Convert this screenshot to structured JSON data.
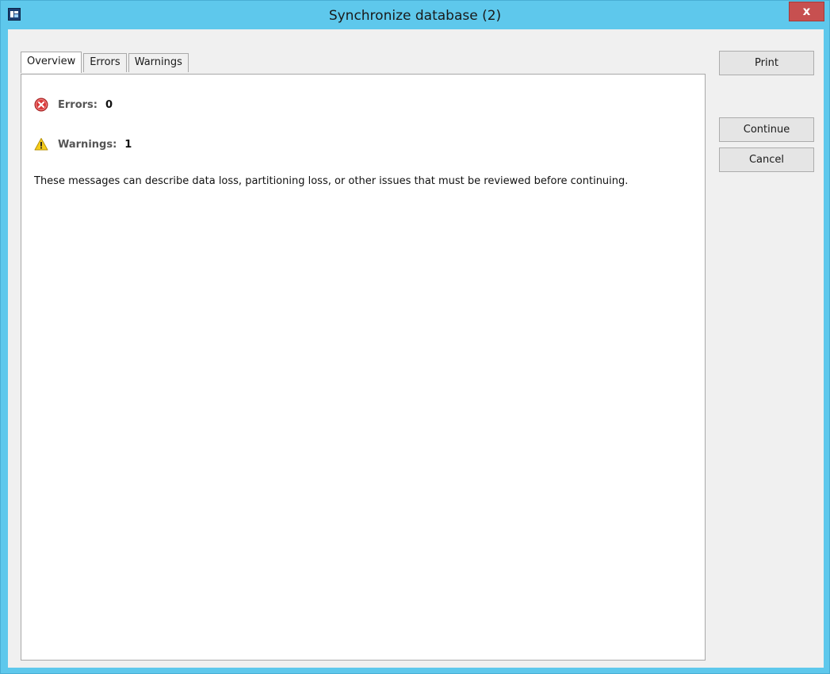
{
  "window": {
    "title": "Synchronize database (2)",
    "close_glyph": "x"
  },
  "tabs": [
    {
      "label": "Overview",
      "active": true
    },
    {
      "label": "Errors",
      "active": false
    },
    {
      "label": "Warnings",
      "active": false
    }
  ],
  "overview": {
    "errors_label": "Errors:",
    "errors_count": "0",
    "warnings_label": "Warnings:",
    "warnings_count": "1",
    "message": "These messages can describe data loss, partitioning loss, or other issues that must be reviewed before continuing."
  },
  "buttons": {
    "print": "Print",
    "continue": "Continue",
    "cancel": "Cancel"
  },
  "icons": {
    "app": "app-icon",
    "close": "close-icon",
    "error": "error-icon",
    "warning": "warning-icon"
  },
  "colors": {
    "title_bar": "#5ec8ec",
    "close_button": "#c75050",
    "client_background": "#f0f0f0",
    "error_red": "#d93a3a",
    "warning_yellow": "#f5cc1b"
  }
}
